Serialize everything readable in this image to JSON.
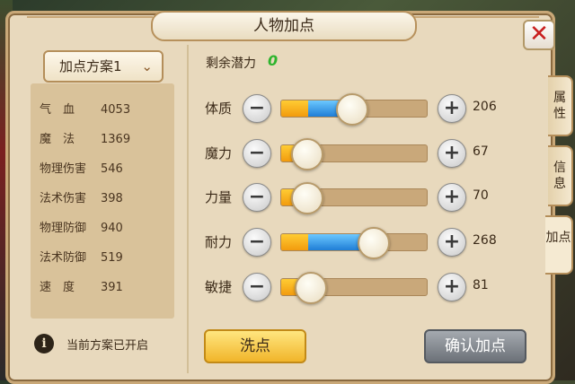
{
  "window": {
    "title": "人物加点"
  },
  "plan": {
    "selected": "加点方案1"
  },
  "stats": [
    {
      "label": "气　血",
      "value": "4053"
    },
    {
      "label": "魔　法",
      "value": "1369"
    },
    {
      "label": "物理伤害",
      "value": "546"
    },
    {
      "label": "法术伤害",
      "value": "398"
    },
    {
      "label": "物理防御",
      "value": "940"
    },
    {
      "label": "法术防御",
      "value": "519"
    },
    {
      "label": "速　度",
      "value": "391"
    }
  ],
  "info": {
    "text": "当前方案已开启"
  },
  "remaining": {
    "label": "剩余潜力",
    "value": "0"
  },
  "attributes": [
    {
      "name": "体质",
      "value": "206",
      "bar_fraction": 0.48
    },
    {
      "name": "魔力",
      "value": "67",
      "bar_fraction": 0.17
    },
    {
      "name": "力量",
      "value": "70",
      "bar_fraction": 0.17
    },
    {
      "name": "耐力",
      "value": "268",
      "bar_fraction": 0.63
    },
    {
      "name": "敏捷",
      "value": "81",
      "bar_fraction": 0.2
    }
  ],
  "buttons": {
    "wash": "洗点",
    "confirm": "确认加点"
  },
  "tabs": [
    "属性",
    "信息",
    "加点"
  ],
  "colors": {
    "remaining_value": "#2db42d",
    "bar_orange": "#f29b0e",
    "bar_blue": "#1f7ed6"
  }
}
